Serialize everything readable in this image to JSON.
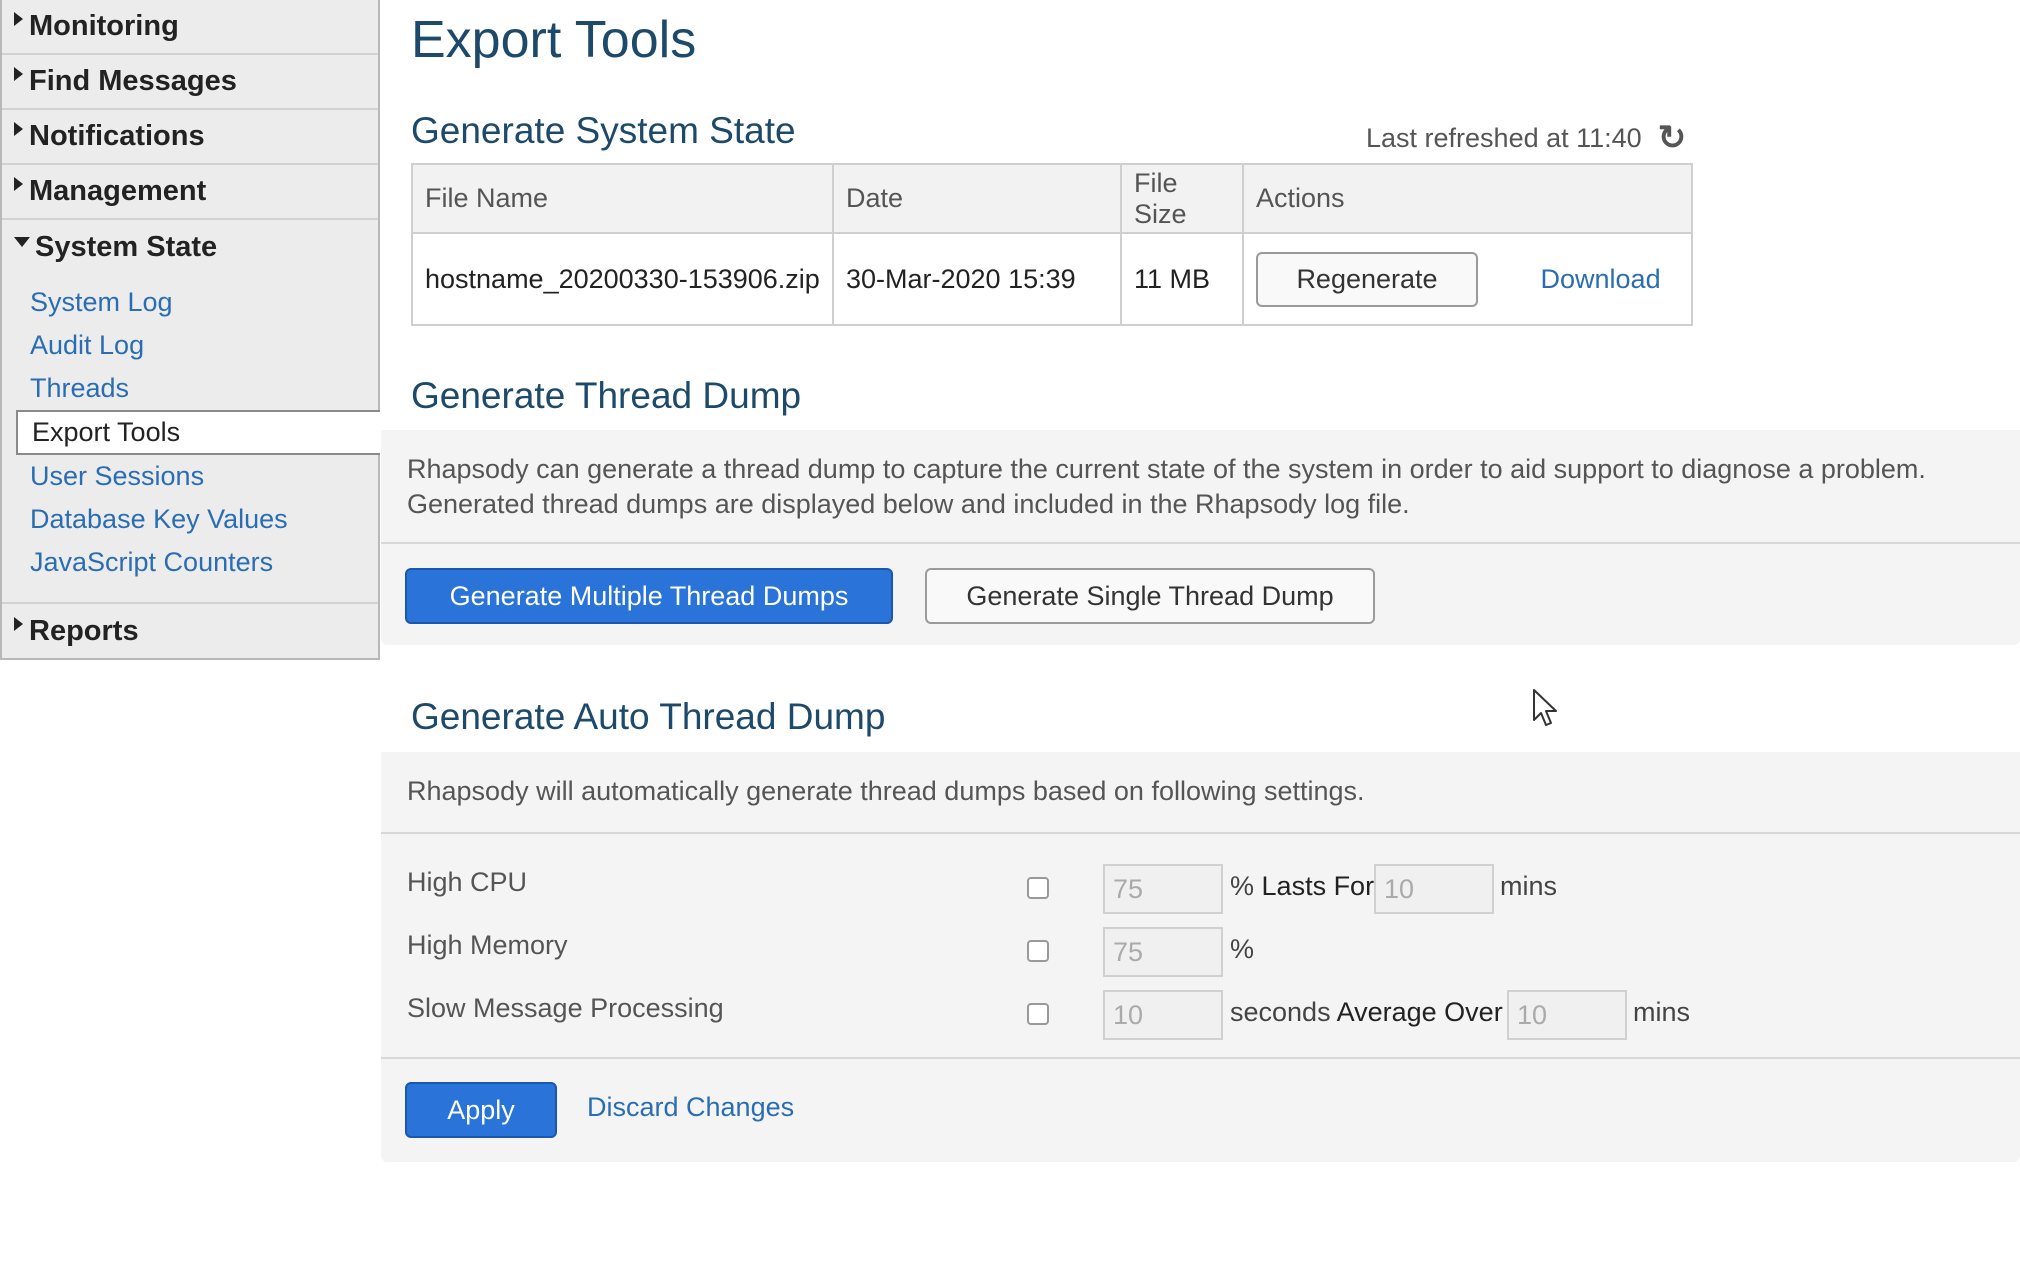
{
  "sidebar": {
    "monitoring": "Monitoring",
    "find_messages": "Find Messages",
    "notifications": "Notifications",
    "management": "Management",
    "system_state": "System State",
    "items": [
      "System Log",
      "Audit Log",
      "Threads",
      "Export Tools",
      "User Sessions",
      "Database Key Values",
      "JavaScript Counters"
    ],
    "reports": "Reports"
  },
  "page": {
    "title": "Export Tools"
  },
  "system_state": {
    "title": "Generate System State",
    "last_refreshed": "Last refreshed at 11:40",
    "columns": [
      "File Name",
      "Date",
      "File Size",
      "Actions"
    ],
    "row": {
      "file_name": "hostname_20200330-153906.zip",
      "date": "30-Mar-2020 15:39",
      "size": "11 MB",
      "regenerate": "Regenerate",
      "download": "Download"
    }
  },
  "thread_dump": {
    "title": "Generate Thread Dump",
    "desc_line1": "Rhapsody can generate a thread dump to capture the current state of the system in order to aid support to diagnose a problem.",
    "desc_line2": "Generated thread dumps are displayed below and included in the Rhapsody log file.",
    "multiple_button": "Generate Multiple Thread Dumps",
    "single_button": "Generate Single Thread Dump"
  },
  "auto_dump": {
    "title": "Generate Auto Thread Dump",
    "desc": "Rhapsody will automatically generate thread dumps based on following settings.",
    "high_cpu": {
      "label": "High CPU",
      "threshold": "75",
      "unit": "%",
      "lasts_for": "Lasts For",
      "duration": "10",
      "duration_unit": "mins"
    },
    "high_memory": {
      "label": "High Memory",
      "threshold": "75",
      "unit": "%"
    },
    "slow_processing": {
      "label": "Slow Message Processing",
      "threshold": "10",
      "unit": "seconds",
      "average_over": "Average Over",
      "duration": "10",
      "duration_unit": "mins"
    },
    "apply": "Apply",
    "discard": "Discard Changes"
  },
  "icons": {
    "refresh": "refresh-icon",
    "cursor": "mouse-pointer-icon"
  },
  "colors": {
    "primary": "#2a73d9",
    "link": "#2a6db3",
    "heading": "#1d4a6b"
  }
}
